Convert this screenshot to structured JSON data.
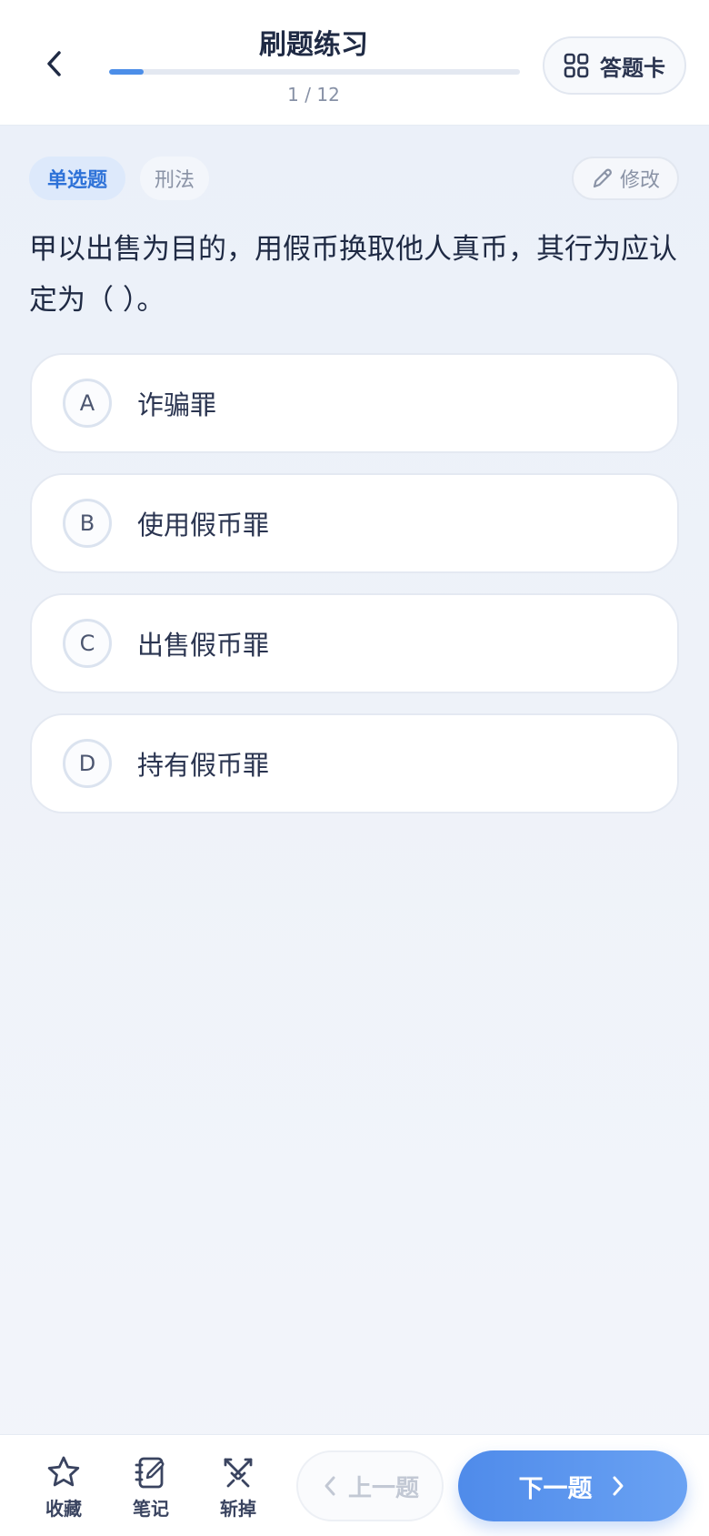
{
  "header": {
    "title": "刷题练习",
    "progress_text": "1 / 12",
    "progress_fraction": 0.083,
    "card_label": "答题卡"
  },
  "tags": {
    "type": "单选题",
    "subject": "刑法"
  },
  "edit_label": "修改",
  "question": "甲以出售为目的，用假币换取他人真币，其行为应认定为（ ）。",
  "options": [
    {
      "letter": "A",
      "text": "诈骗罪"
    },
    {
      "letter": "B",
      "text": "使用假币罪"
    },
    {
      "letter": "C",
      "text": "出售假币罪"
    },
    {
      "letter": "D",
      "text": "持有假币罪"
    }
  ],
  "toolbar": {
    "favorite_label": "收藏",
    "notes_label": "笔记",
    "remove_label": "斩掉",
    "prev_label": "上一题",
    "next_label": "下一题"
  },
  "colors": {
    "accent": "#4c8ee8",
    "tag_bg": "#dde9fb",
    "tag_text": "#2e72d8"
  },
  "icons": {
    "back": "chevron-left-icon",
    "card": "grid-icon",
    "edit": "pencil-icon",
    "favorite": "star-icon",
    "notes": "notebook-icon",
    "remove": "swords-icon",
    "prev": "chevron-left-icon",
    "next": "chevron-right-icon"
  }
}
